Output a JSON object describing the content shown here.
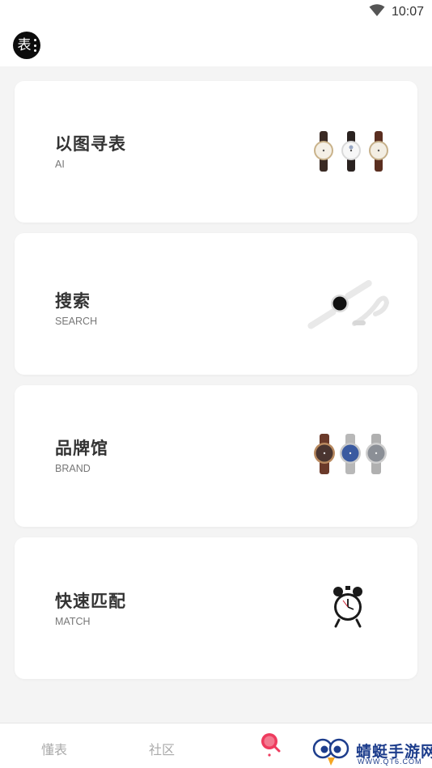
{
  "status_bar": {
    "time": "10:07",
    "icon": "wifi-icon"
  },
  "header": {
    "logo_text": "表",
    "logo_icon": "app-logo"
  },
  "cards": [
    {
      "title": "以图寻表",
      "subtitle": "AI",
      "image": "three-watches-leather-image"
    },
    {
      "title": "搜索",
      "subtitle": "SEARCH",
      "image": "white-smartwatch-image"
    },
    {
      "title": "品牌馆",
      "subtitle": "BRAND",
      "image": "three-watches-steel-image"
    },
    {
      "title": "快速匹配",
      "subtitle": "MATCH",
      "image": "alarm-clock-image"
    }
  ],
  "tabbar": {
    "tabs": [
      {
        "label": "懂表"
      },
      {
        "label": "社区"
      },
      {
        "label": "",
        "icon": "center-tab-icon"
      }
    ],
    "accent": "#ee3b5e"
  },
  "watermark": {
    "title": "蜻蜓手游网",
    "url": "WWW.QT6.COM"
  },
  "colors": {
    "background": "#f4f4f4",
    "card": "#ffffff",
    "title": "#333333",
    "subtitle": "#777777",
    "tab_inactive": "#aaaaaa"
  }
}
